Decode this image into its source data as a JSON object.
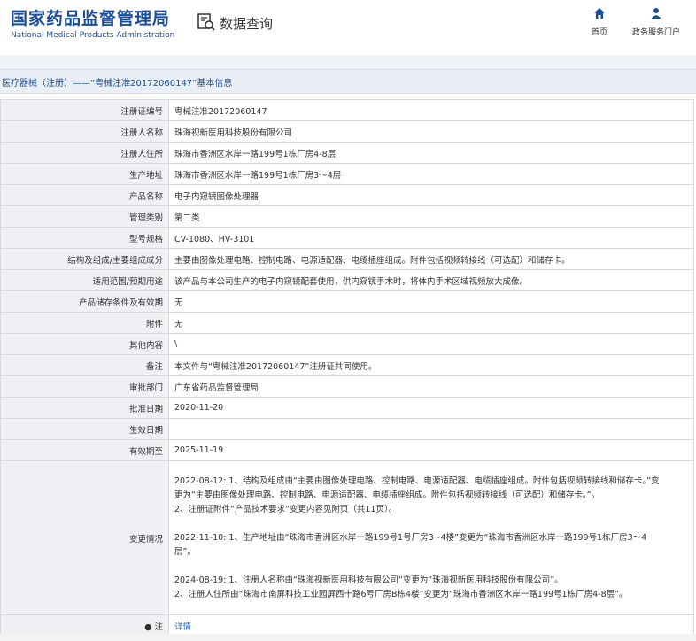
{
  "header": {
    "brand_cn": "国家药品监督管理局",
    "brand_en": "National Medical Products Administration",
    "query_title": "数据查询",
    "nav": [
      {
        "label": "首页",
        "icon": "home-icon"
      },
      {
        "label": "政务服务门户",
        "icon": "user-icon"
      }
    ]
  },
  "colors": {
    "brand": "#1a4e9c",
    "link": "#2a66c4"
  },
  "page_title": "医疗器械（注册）——“粤械注准20172060147”基本信息",
  "rows": [
    {
      "label": "注册证编号",
      "value": "粤械注准20172060147"
    },
    {
      "label": "注册人名称",
      "value": "珠海视新医用科技股份有限公司"
    },
    {
      "label": "注册人住所",
      "value": "珠海市香洲区水岸一路199号1栋厂房4-8层"
    },
    {
      "label": "生产地址",
      "value": "珠海市香洲区水岸一路199号1栋厂房3～4层"
    },
    {
      "label": "产品名称",
      "value": "电子内窥镜图像处理器"
    },
    {
      "label": "管理类别",
      "value": "第二类"
    },
    {
      "label": "型号规格",
      "value": "CV-1080、HV-3101"
    },
    {
      "label": "结构及组成/主要组成成分",
      "value": "主要由图像处理电路、控制电路、电源适配器、电缆插座组成。附件包括视频转接线（可选配）和储存卡。"
    },
    {
      "label": "适用范围/预期用途",
      "value": "该产品与本公司生产的电子内窥镜配套使用，供内窥镜手术时，将体内手术区域视频放大成像。"
    },
    {
      "label": "产品储存条件及有效期",
      "value": "无"
    },
    {
      "label": "附件",
      "value": "无"
    },
    {
      "label": "其他内容",
      "value": "\\"
    },
    {
      "label": "备注",
      "value": "本文件与“粤械注准20172060147”注册证共同使用。"
    },
    {
      "label": "审批部门",
      "value": "广东省药品监督管理局"
    },
    {
      "label": "批准日期",
      "value": "2020-11-20"
    },
    {
      "label": "生效日期",
      "value": ""
    },
    {
      "label": "有效期至",
      "value": "2025-11-19"
    }
  ],
  "change": {
    "label": "变更情况",
    "lines": [
      "2022-08-12: 1、结构及组成由“主要由图像处理电路、控制电路、电源适配器、电缆插座组成。附件包括视频转接线和储存卡。”变",
      "更为“主要由图像处理电路、控制电路、电源适配器、电缆插座组成。附件包括视频转接线（可选配）和储存卡。”。",
      "2、注册证附件“产品技术要求”变更内容见附页（共11页）。",
      "",
      "2022-11-10: 1、生产地址由“珠海市香洲区水岸一路199号1号厂房3~4楼”变更为“珠海市香洲区水岸一路199号1栋厂房3～4",
      "层”。",
      "",
      "2024-08-19: 1、注册人名称由“珠海视新医用科技有限公司”变更为“珠海视新医用科技股份有限公司”。",
      "2、注册人住所由“珠海市南屏科技工业园屏西十路6号厂房B栋4楼”变更为“珠海市香洲区水岸一路199号1栋厂房4-8层”。"
    ]
  },
  "note": {
    "label": "注",
    "link": "详情"
  }
}
